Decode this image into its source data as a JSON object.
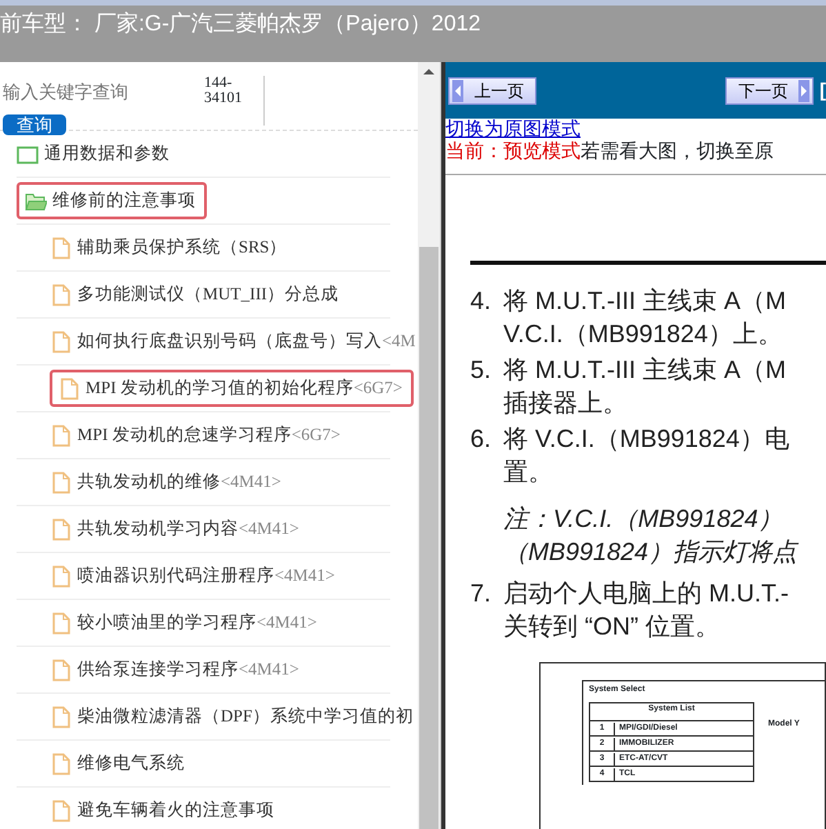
{
  "header": {
    "title": "前车型： 厂家:G-广汽三菱帕杰罗（Pajero）2012"
  },
  "sidebar": {
    "search": {
      "placeholder": "输入关键字查询",
      "button": "查询"
    },
    "code": "144-34101",
    "tree": [
      {
        "label": "通用数据和参数",
        "expanded": false,
        "selected": false
      },
      {
        "label": "维修前的注意事项",
        "expanded": true,
        "selected": true,
        "children": [
          {
            "label": "辅助乘员保护系统（SRS）",
            "selected": false
          },
          {
            "label": "多功能测试仪（MUT_III）分总成",
            "selected": false
          },
          {
            "label": "如何执行底盘识别号码（底盘号）写入",
            "tag": "<4M",
            "selected": false
          },
          {
            "label": "MPI 发动机的学习值的初始化程序",
            "tag": "<6G7>",
            "selected": true
          },
          {
            "label": "MPI 发动机的怠速学习程序",
            "tag": "<6G7>",
            "selected": false
          },
          {
            "label": "共轨发动机的维修",
            "tag": "<4M41>",
            "selected": false
          },
          {
            "label": "共轨发动机学习内容",
            "tag": "<4M41>",
            "selected": false
          },
          {
            "label": "喷油器识别代码注册程序",
            "tag": "<4M41>",
            "selected": false
          },
          {
            "label": "较小喷油里的学习程序",
            "tag": "<4M41>",
            "selected": false
          },
          {
            "label": "供给泵连接学习程序",
            "tag": "<4M41>",
            "selected": false
          },
          {
            "label": "柴油微粒滤清器（DPF）系统中学习值的初",
            "selected": false
          },
          {
            "label": "维修电气系统",
            "selected": false
          },
          {
            "label": "避免车辆着火的注意事项",
            "selected": false
          }
        ]
      }
    ]
  },
  "viewer": {
    "prev_button": "上一页",
    "next_button": "下一页",
    "extra_link": "[",
    "mode_link": "切换为原图模式",
    "mode_status": "当前：预览模式",
    "mode_hint": "若需看大图，切换至原",
    "document": {
      "steps": [
        {
          "kind": "step",
          "number": "4.",
          "lines": [
            "将 M.U.T.-III 主线束 A（M",
            "V.C.I.（MB991824）上。"
          ]
        },
        {
          "kind": "step",
          "number": "5.",
          "lines": [
            "将 M.U.T.-III 主线束 A（M",
            "插接器上。"
          ]
        },
        {
          "kind": "step",
          "number": "6.",
          "lines": [
            "将 V.C.I.（MB991824）电",
            "置。"
          ]
        },
        {
          "kind": "note",
          "lines": [
            "注：V.C.I.（MB991824）",
            "（MB991824）指示灯将点"
          ]
        },
        {
          "kind": "step",
          "number": "7.",
          "lines": [
            "启动个人电脑上的 M.U.T.-",
            "关转到 “ON” 位置。"
          ]
        }
      ],
      "figure": {
        "title": "System Select",
        "list_header": "System List",
        "side_label": "Model Y",
        "rows": [
          {
            "number": "1",
            "label": "MPI/GDI/Diesel"
          },
          {
            "number": "2",
            "label": "IMMOBILIZER"
          },
          {
            "number": "3",
            "label": "ETC-AT/CVT"
          },
          {
            "number": "4",
            "label": "TCL"
          }
        ]
      }
    }
  }
}
